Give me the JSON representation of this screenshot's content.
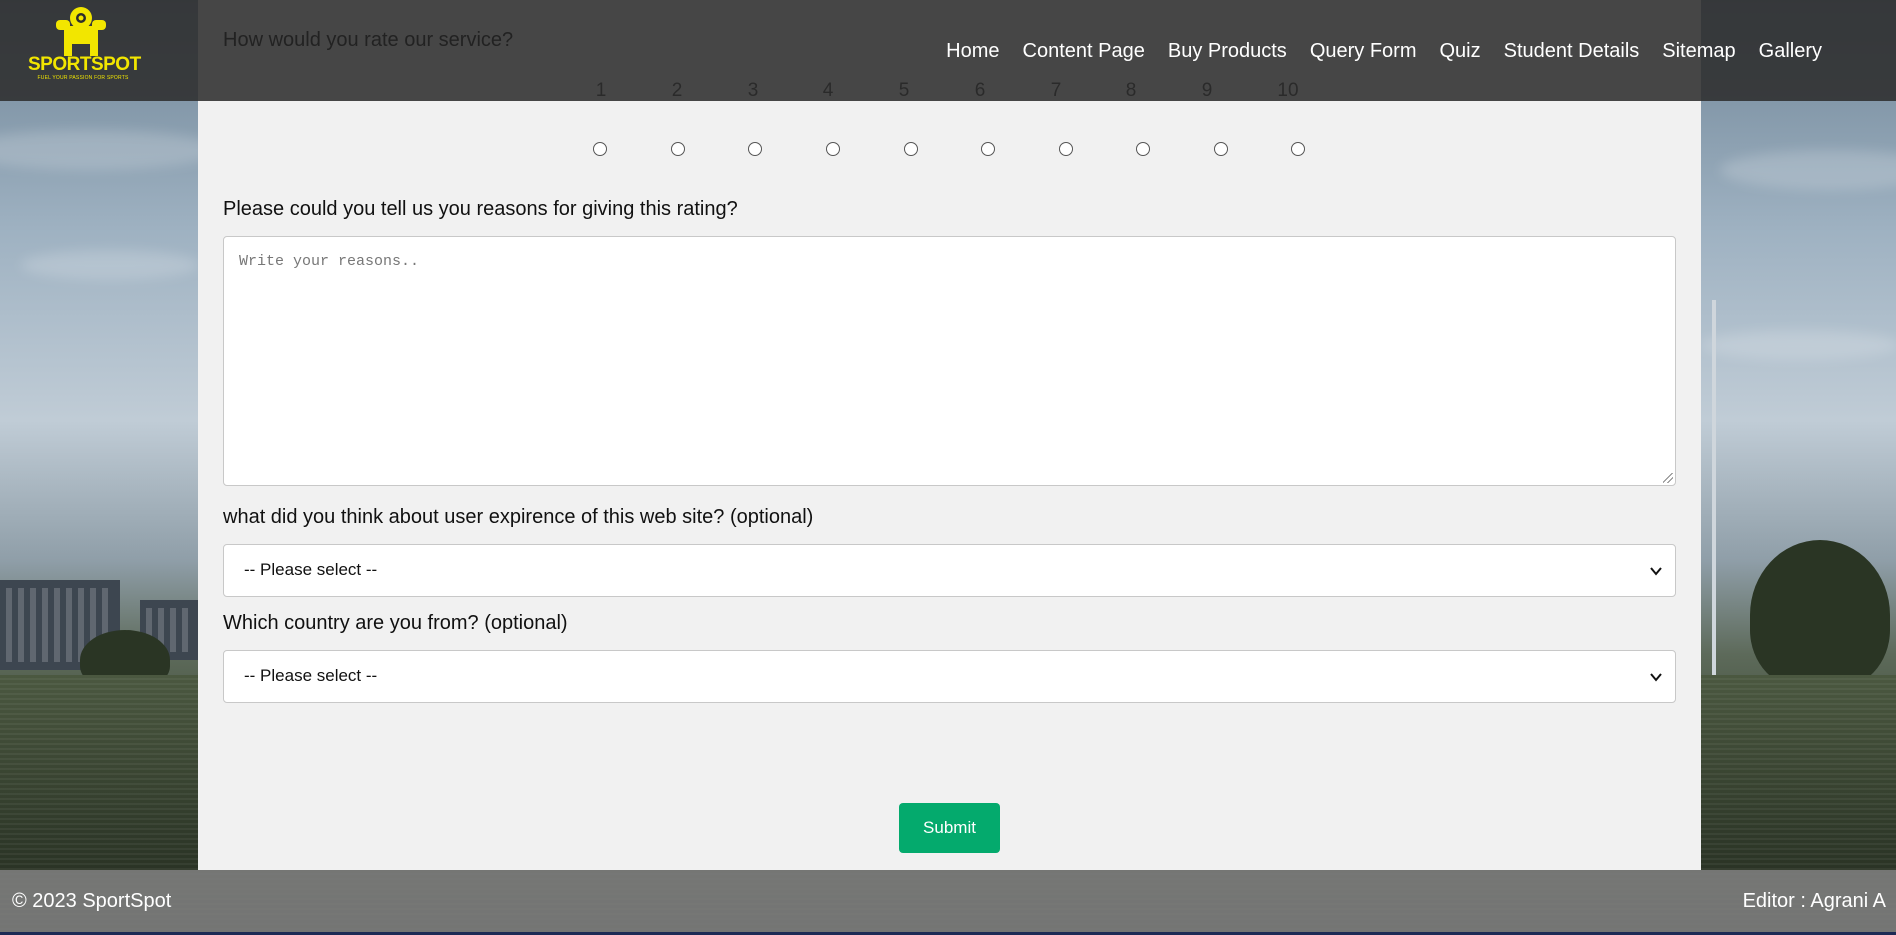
{
  "brand": {
    "name": "SPORTSPOT",
    "tagline": "FUEL YOUR PASSION FOR SPORTS",
    "logo_color": "#f2e600"
  },
  "nav": {
    "items": [
      "Home",
      "Content Page",
      "Buy Products",
      "Query Form",
      "Quiz",
      "Student Details",
      "Sitemap",
      "Gallery"
    ]
  },
  "form": {
    "rating_question": "How would you rate our service?",
    "rating_scale": [
      "1",
      "2",
      "3",
      "4",
      "5",
      "6",
      "7",
      "8",
      "9",
      "10"
    ],
    "reasons_question": "Please could you tell us you reasons for giving this rating?",
    "reasons_placeholder": "Write your reasons..",
    "ux_question": "what did you think about user expirence of this web site? (optional)",
    "ux_select_value": "-- Please select --",
    "country_question": "Which country are you from? (optional)",
    "country_select_value": "-- Please select --",
    "submit_label": "Submit",
    "submit_color": "#04aa6d"
  },
  "footer": {
    "copyright": "© 2023 SportSpot",
    "editor": "Editor : Agrani A"
  }
}
